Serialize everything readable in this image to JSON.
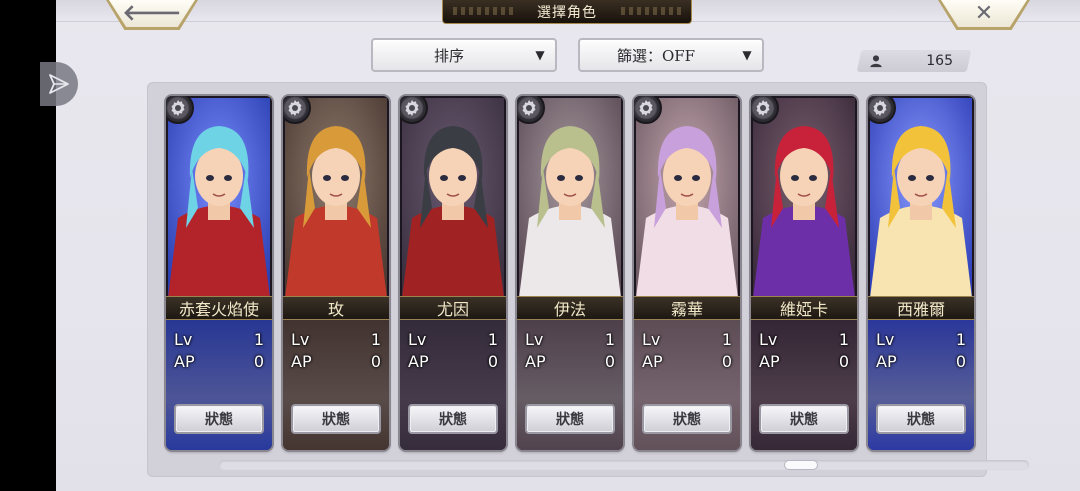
{
  "header": {
    "title": "選擇角色",
    "back_glyph": "🡐",
    "close_glyph": "✕"
  },
  "controls": {
    "sort_label": "排序",
    "filter_label": "篩選：OFF",
    "caret": "▼",
    "character_count": "165"
  },
  "cards": [
    {
      "name": "赤套火焰使",
      "lv_label": "Lv",
      "lv": "1",
      "ap_label": "AP",
      "ap": "0",
      "status_label": "狀態",
      "hair": "#6fd3e6",
      "coat": "#b3232a",
      "bg": "#2a3fb0",
      "glow": "#7a8cff"
    },
    {
      "name": "玫",
      "lv_label": "Lv",
      "lv": "1",
      "ap_label": "AP",
      "ap": "0",
      "status_label": "狀態",
      "hair": "#d99a3a",
      "coat": "#c0392b",
      "bg": "#4b3a33",
      "glow": "#8f7a6c"
    },
    {
      "name": "尤因",
      "lv_label": "Lv",
      "lv": "1",
      "ap_label": "AP",
      "ap": "0",
      "status_label": "狀態",
      "hair": "#3b3d45",
      "coat": "#a12222",
      "bg": "#3a3040",
      "glow": "#6a5a70"
    },
    {
      "name": "伊法",
      "lv_label": "Lv",
      "lv": "1",
      "ap_label": "AP",
      "ap": "0",
      "status_label": "狀態",
      "hair": "#b9c08d",
      "coat": "#ece8ea",
      "bg": "#5a4a55",
      "glow": "#a89aa0"
    },
    {
      "name": "霧華",
      "lv_label": "Lv",
      "lv": "1",
      "ap_label": "AP",
      "ap": "0",
      "status_label": "狀態",
      "hair": "#c8a0dc",
      "coat": "#f1dde6",
      "bg": "#6d5a62",
      "glow": "#c4a6b0"
    },
    {
      "name": "維婭卡",
      "lv_label": "Lv",
      "lv": "1",
      "ap_label": "AP",
      "ap": "0",
      "status_label": "狀態",
      "hair": "#c7223a",
      "coat": "#6d2fa8",
      "bg": "#3a2a3a",
      "glow": "#7a6070"
    },
    {
      "name": "西雅爾",
      "lv_label": "Lv",
      "lv": "1",
      "ap_label": "AP",
      "ap": "0",
      "status_label": "狀態",
      "hair": "#f2c23a",
      "coat": "#f7e4b0",
      "bg": "#2f3fb8",
      "glow": "#8a9cff"
    }
  ],
  "icons": {
    "float": "send-arrow-icon",
    "person": "person-icon",
    "gear": "gear-icon"
  }
}
